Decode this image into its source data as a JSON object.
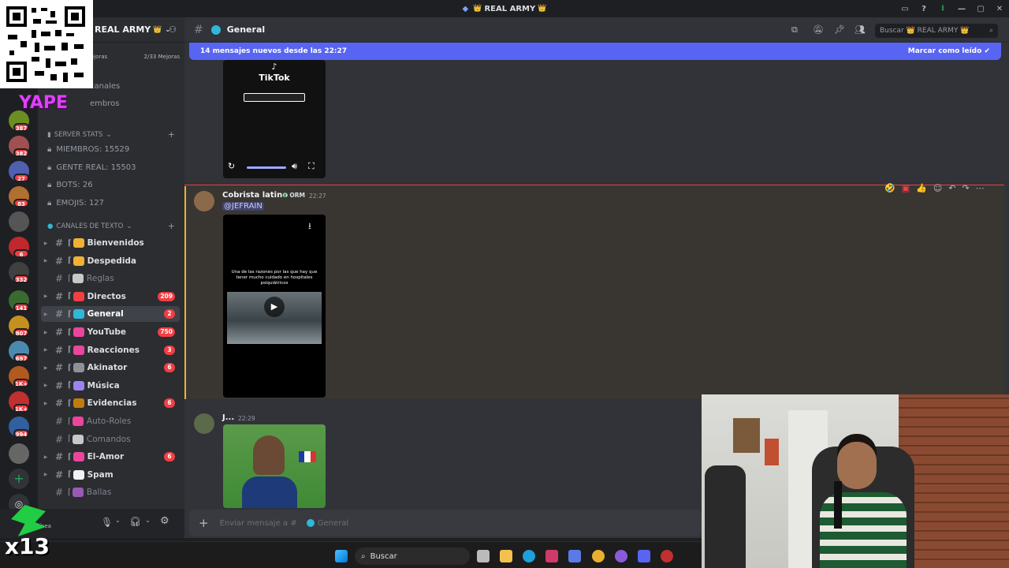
{
  "window": {
    "title": "REAL ARMY",
    "title_emoji_left": "👑",
    "title_emoji_right": "👑"
  },
  "server": {
    "name": "REAL ARMY",
    "boosts_left": "mejoras",
    "boosts_right": "2/33 Mejoras",
    "nav_canales": "canales",
    "nav_miembros": "embros"
  },
  "stats_category": {
    "label": "SERVER STATS",
    "items": [
      "MIEMBROS: 15529",
      "GENTE REAL: 15503",
      "BOTS: 26",
      "EMOJIS: 127"
    ]
  },
  "text_category": {
    "label": "CANALES DE TEXTO"
  },
  "channels": [
    {
      "name": "Bienvenidos",
      "badge": "",
      "muted": false,
      "color": "#f0b232"
    },
    {
      "name": "Despedida",
      "badge": "",
      "muted": false,
      "color": "#f0b232"
    },
    {
      "name": "Reglas",
      "badge": "",
      "muted": true,
      "color": "#c8c8c8"
    },
    {
      "name": "Directos",
      "badge": "209",
      "muted": false,
      "color": "#f23f43"
    },
    {
      "name": "General",
      "badge": "2",
      "muted": false,
      "color": "#2fb8d8"
    },
    {
      "name": "YouTube",
      "badge": "750",
      "muted": false,
      "color": "#eb459e"
    },
    {
      "name": "Reacciones",
      "badge": "3",
      "muted": false,
      "color": "#eb459e"
    },
    {
      "name": "Akinator",
      "badge": "6",
      "muted": false,
      "color": "#8e9297"
    },
    {
      "name": "Música",
      "badge": "",
      "muted": false,
      "color": "#9b84ee"
    },
    {
      "name": "Evidencias",
      "badge": "6",
      "muted": false,
      "color": "#c27c0e"
    },
    {
      "name": "Auto-Roles",
      "badge": "",
      "muted": true,
      "color": "#eb459e"
    },
    {
      "name": "Comandos",
      "badge": "",
      "muted": true,
      "color": "#c8c8c8"
    },
    {
      "name": "El-Amor",
      "badge": "6",
      "muted": false,
      "color": "#eb459e"
    },
    {
      "name": "Spam",
      "badge": "",
      "muted": false,
      "color": "#f2f3f5"
    },
    {
      "name": "Ballas",
      "badge": "",
      "muted": true,
      "color": "#9b59b6"
    }
  ],
  "rail_badges": [
    "387",
    "382",
    "27",
    "83",
    "6",
    "332",
    "141",
    "807",
    "697",
    "1K+",
    "1K+",
    "994"
  ],
  "channel_header": {
    "name": "General",
    "search_label": "Buscar",
    "search_server": "REAL ARMY"
  },
  "new_messages": {
    "text": "14 mensajes nuevos desde las 22:27",
    "action": "Marcar como leído"
  },
  "tiktok_embed": {
    "brand": "TikTok"
  },
  "messages": [
    {
      "author": "Cobrista latino",
      "tag": "ORM",
      "time": "22:27",
      "mention": "@JEFRAIN",
      "video_caption": "Una de las razones por las que hay que tener mucho cuidado en hospitales psiquiátricos"
    },
    {
      "author": "J...",
      "time": "22:29"
    }
  ],
  "composer": {
    "placeholder": "Enviar mensaje a #",
    "channel": "General"
  },
  "user_panel": {
    "status": "línea",
    "status2": "blado"
  },
  "taskbar": {
    "search": "Buscar"
  },
  "overlays": {
    "yape": "YAPE",
    "x13": "x13"
  },
  "colors": {
    "accent": "#5865f2",
    "badge": "#f23f43",
    "sidebar": "#2b2d31",
    "chat": "#313338"
  }
}
